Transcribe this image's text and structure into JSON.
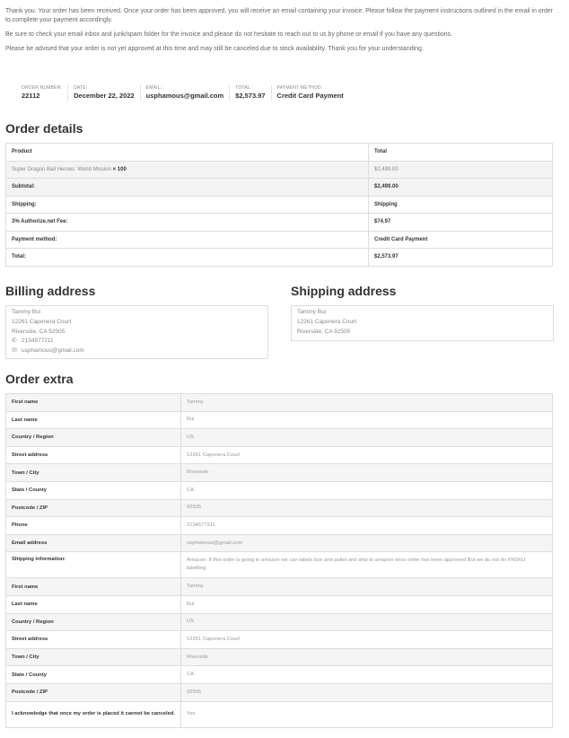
{
  "intro": {
    "p1": "Thank you. Your order has been received. Once your order has been approved, you will receive an email containing your invoice. Please follow the payment instructions outlined in the email in order to complete your payment accordingly.",
    "p2": "Be sure to check your email inbox and junk/spam folder for the invoice and please do not hesitate to reach out to us by phone or email if you have any questions.",
    "p3": "Please be advised that your order is not yet approved at this time and may still be canceled due to stock availability. Thank you for your understanding."
  },
  "overview": [
    {
      "label": "ORDER NUMBER:",
      "value": "22112"
    },
    {
      "label": "DATE:",
      "value": "December 22, 2022"
    },
    {
      "label": "EMAIL:",
      "value": "usphamous@gmail.com"
    },
    {
      "label": "TOTAL:",
      "value": "$2,573.97"
    },
    {
      "label": "PAYMENT METHOD:",
      "value": "Credit Card Payment"
    }
  ],
  "order_details": {
    "title": "Order details",
    "head": {
      "product": "Product",
      "total": "Total"
    },
    "item": {
      "name": "Super Dragon Ball Heroes: World Mission",
      "qty": "× 100",
      "total": "$2,499.00"
    },
    "rows": [
      {
        "label": "Subtotal:",
        "value": "$2,499.00"
      },
      {
        "label": "Shipping:",
        "value": "Shipping"
      },
      {
        "label": "3% Authorize.net Fee:",
        "value": "$74.97"
      },
      {
        "label": "Payment method:",
        "value": "Credit Card Payment"
      },
      {
        "label": "Total:",
        "value": "$2,573.97"
      }
    ]
  },
  "billing": {
    "title": "Billing address",
    "name": "Tammy Bui",
    "street": "12261 Caponera Court",
    "city": "Riverside, CA 92505",
    "phone": "2134577211",
    "email": "usphamous@gmail.com"
  },
  "shipping": {
    "title": "Shipping address",
    "name": "Tammy Bui",
    "street": "12261 Caponera Court",
    "city": "Riverside, CA 92505"
  },
  "order_extra": {
    "title": "Order extra",
    "rows": [
      {
        "k": "First name",
        "v": "Tammy"
      },
      {
        "k": "Last name",
        "v": "Bui"
      },
      {
        "k": "Country / Region",
        "v": "US"
      },
      {
        "k": "Street address",
        "v": "12261 Caponera Court"
      },
      {
        "k": "Town / City",
        "v": "Riverside"
      },
      {
        "k": "State / County",
        "v": "CA"
      },
      {
        "k": "Postcode / ZIP",
        "v": "92505"
      },
      {
        "k": "Phone",
        "v": "2134577211"
      },
      {
        "k": "Email address",
        "v": "usphamous@gmail.com"
      },
      {
        "k": "Shipping information:",
        "v": "Amazon: If this order is going to amazon we can labels box and pallet and ship to amazon once order has been approved But we do not do FNSKU labelling."
      },
      {
        "k": "First name",
        "v": "Tammy"
      },
      {
        "k": "Last name",
        "v": "Bui"
      },
      {
        "k": "Country / Region",
        "v": "US"
      },
      {
        "k": "Street address",
        "v": "12261 Caponera Court"
      },
      {
        "k": "Town / City",
        "v": "Riverside"
      },
      {
        "k": "State / County",
        "v": "CA"
      },
      {
        "k": "Postcode / ZIP",
        "v": "92505"
      },
      {
        "k": "I acknowledge that once my order is placed it cannot be canceled.",
        "v": "Yes"
      }
    ]
  }
}
